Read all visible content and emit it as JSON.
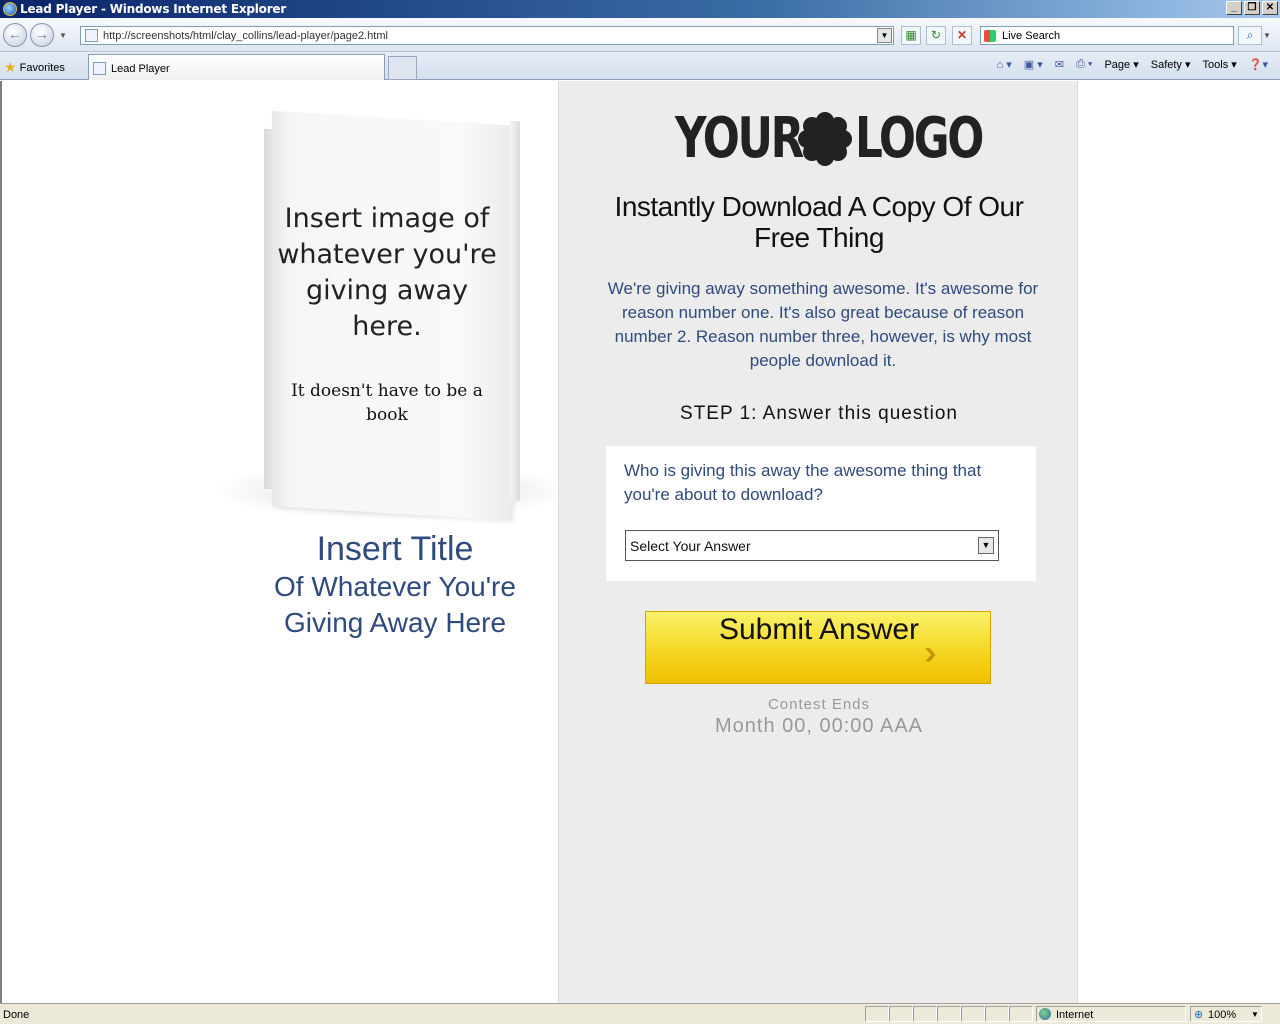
{
  "window": {
    "title": "Lead Player - Windows Internet Explorer",
    "minimize": "_",
    "maximize": "❐",
    "close": "✕"
  },
  "address_bar": {
    "url": "http://screenshots/html/clay_collins/lead-player/page2.html",
    "search_placeholder": "Live Search"
  },
  "toolbar": {
    "favorites_label": "Favorites",
    "tab_label": "Lead Player",
    "commands": [
      "Page",
      "Safety",
      "Tools"
    ]
  },
  "page": {
    "book_text_main": "Insert image of whatever you're giving away here.",
    "book_text_sub": "It doesn't have to be a book",
    "insert_title_line1": "Insert Title",
    "insert_title_line2": "Of Whatever You're",
    "insert_title_line3": "Giving Away Here",
    "logo_left": "YOUR",
    "logo_right": "LOGO",
    "headline": "Instantly Download A Copy Of Our Free Thing",
    "description": "We're giving away something awesome. It's awesome for reason number one. It's also great because of reason number 2. Reason number three, however, is why most people download it.",
    "step": "STEP 1: Answer this question",
    "question": "Who is giving this away the awesome thing that you're about to download?",
    "select_value": "Select Your Answer",
    "submit_label": "Submit Answer",
    "contest_label": "Contest Ends",
    "contest_date": "Month 00, 00:00 AAA"
  },
  "status_bar": {
    "status": "Done",
    "zone": "Internet",
    "zoom": "100%"
  },
  "colors": {
    "accent_blue": "#2f4a7c",
    "button_yellow": "#f6d92a",
    "panel_gray": "#ececec"
  }
}
